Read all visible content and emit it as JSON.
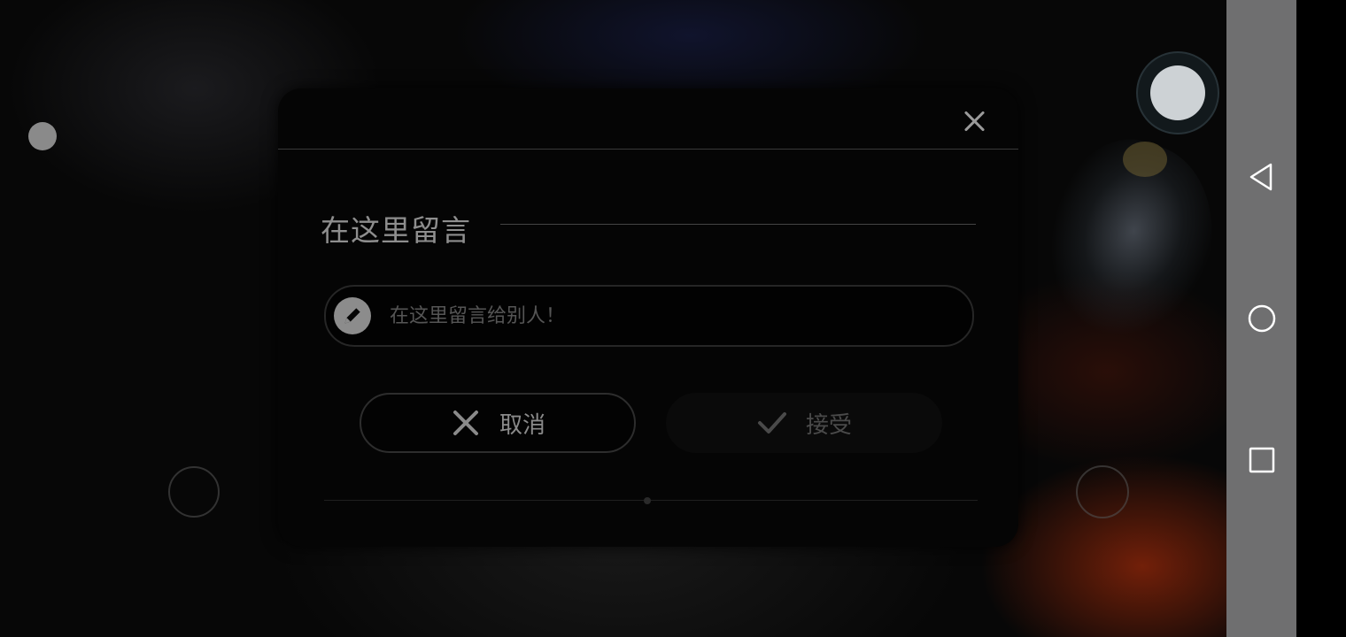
{
  "dialog": {
    "title": "在这里留言",
    "message": {
      "placeholder": "在这里留言给别人！",
      "value": ""
    },
    "cancel_label": "取消",
    "accept_label": "接受"
  },
  "icons": {
    "close": "close-icon",
    "pencil": "pencil-icon",
    "cancel": "x-icon",
    "accept": "checkmark-icon",
    "nav_back": "back-triangle-icon",
    "nav_home": "home-circle-icon",
    "nav_recents": "recents-square-icon"
  },
  "colors": {
    "dialog_bg": "#050505",
    "navbar_bg": "#6f6f70",
    "text_muted": "#8e8e8e"
  }
}
